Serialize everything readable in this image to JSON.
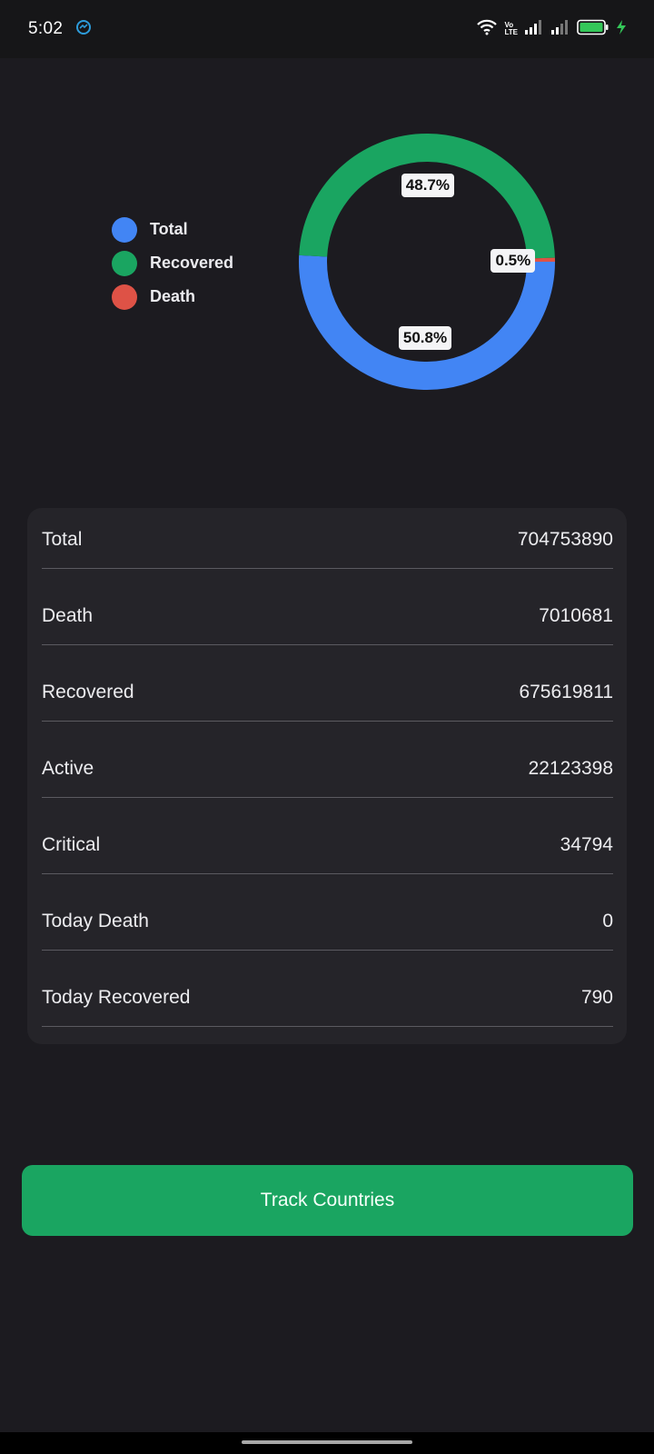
{
  "status_bar": {
    "time": "5:02",
    "volte_top": "Vo",
    "volte_bottom": "LTE"
  },
  "colors": {
    "total": "#4285f4",
    "recovered": "#1aa561",
    "death": "#de5246",
    "button": "#1aa561"
  },
  "legend": [
    {
      "label": "Total"
    },
    {
      "label": "Recovered"
    },
    {
      "label": "Death"
    }
  ],
  "chart_data": {
    "type": "pie",
    "style": "donut",
    "categories": [
      "Total",
      "Recovered",
      "Death"
    ],
    "values": [
      50.8,
      48.7,
      0.5
    ],
    "labels": [
      "50.8%",
      "48.7%",
      "0.5%"
    ],
    "legend_position": "left"
  },
  "stats": [
    {
      "label": "Total",
      "value": "704753890"
    },
    {
      "label": "Death",
      "value": "7010681"
    },
    {
      "label": "Recovered",
      "value": "675619811"
    },
    {
      "label": "Active",
      "value": "22123398"
    },
    {
      "label": "Critical",
      "value": "34794"
    },
    {
      "label": "Today Death",
      "value": "0"
    },
    {
      "label": "Today Recovered",
      "value": "790"
    }
  ],
  "button": {
    "label": "Track Countries"
  }
}
